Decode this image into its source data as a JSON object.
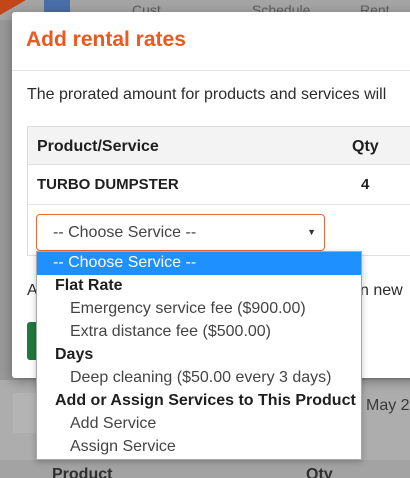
{
  "background": {
    "topbar_fragments": [
      "Cust",
      "Schedule",
      "Rent"
    ],
    "right_fragment": "May 2",
    "table_headers": {
      "product": "Product",
      "qty": "Qty"
    }
  },
  "modal": {
    "title": "Add rental rates",
    "description": "The prorated amount for products and services will",
    "table": {
      "headers": {
        "product": "Product/Service",
        "qty": "Qty"
      },
      "rows": [
        {
          "product": "TURBO DUMPSTER",
          "qty": "4"
        }
      ]
    },
    "select": {
      "value": "-- Choose Service --"
    },
    "below_left": "A",
    "below_right": "n new"
  },
  "dropdown": {
    "options": [
      {
        "label": "-- Choose Service --",
        "kind": "selected"
      },
      {
        "label": "Flat Rate",
        "kind": "group"
      },
      {
        "label": "Emergency service fee ($900.00)",
        "kind": "item"
      },
      {
        "label": "Extra distance fee ($500.00)",
        "kind": "item"
      },
      {
        "label": "Days",
        "kind": "group"
      },
      {
        "label": "Deep cleaning ($50.00 every 3 days)",
        "kind": "item"
      },
      {
        "label": "Add or Assign Services to This Product",
        "kind": "group"
      },
      {
        "label": "Add Service",
        "kind": "item"
      },
      {
        "label": "Assign Service",
        "kind": "item"
      }
    ]
  },
  "colors": {
    "accent": "#ea5a1f",
    "selection": "#1e90ff"
  }
}
